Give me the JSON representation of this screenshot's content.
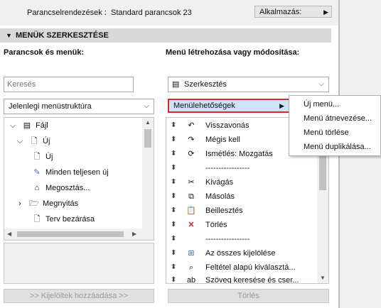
{
  "header": {
    "label": "Parancselrendezések :",
    "value": "Standard parancsok 23",
    "apply_button": "Alkalmazás:"
  },
  "section": {
    "title": "MENÜK SZERKESZTÉSE"
  },
  "left": {
    "title": "Parancsok és menük:",
    "search_placeholder": "Keresés",
    "structure_select": "Jelenlegi menüstruktúra",
    "tree": [
      {
        "label": "Fájl"
      },
      {
        "label": "Új"
      },
      {
        "label": "Új"
      },
      {
        "label": "Minden teljesen új"
      },
      {
        "label": "Megosztás..."
      },
      {
        "label": "Megnyitás"
      },
      {
        "label": "Terv bezárása"
      }
    ],
    "add_button": ">> Kijelöltek hozzáadása >>"
  },
  "right": {
    "title": "Menü létrehozása vagy módosítása:",
    "menu_select": "Szerkesztés",
    "options_button": "Menülehetőségek",
    "items": [
      {
        "label": "Visszavonás",
        "icon": "undo-icon"
      },
      {
        "label": "Mégis kell",
        "icon": "redo-icon"
      },
      {
        "label": "Ismétlés: Mozgatás",
        "icon": "repeat-icon"
      },
      {
        "label": "-----------------",
        "icon": ""
      },
      {
        "label": "Kivágás",
        "icon": "scissors-icon"
      },
      {
        "label": "Másolás",
        "icon": "copy-icon"
      },
      {
        "label": "Beillesztés",
        "icon": "paste-icon"
      },
      {
        "label": "Törlés",
        "icon": "delete-icon"
      },
      {
        "label": "-----------------",
        "icon": ""
      },
      {
        "label": "Az összes kijelölése",
        "icon": "select-all-icon"
      },
      {
        "label": "Feltétel alapú kiválasztá...",
        "icon": "find-select-icon"
      },
      {
        "label": "Szöveg keresése és cser...",
        "icon": "find-replace-icon"
      }
    ],
    "delete_button": "Törlés"
  },
  "popup_menu": [
    "Új menü...",
    "Menü átnevezése...",
    "Menü törlése",
    "Menü duplikálása..."
  ],
  "colors": {
    "highlight_border": "#d9262f",
    "highlight_fill": "#cfe3f7",
    "section_bg": "#d9d9d9"
  }
}
